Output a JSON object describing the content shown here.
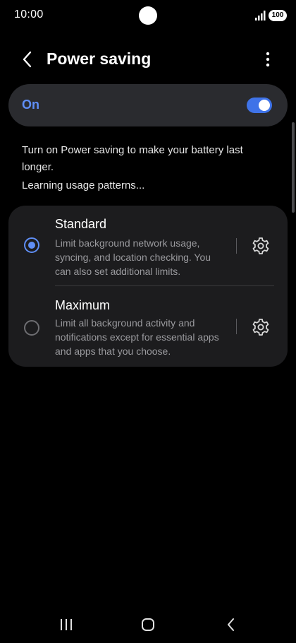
{
  "status_bar": {
    "time": "10:00",
    "battery": "100",
    "icons": [
      "signal-icon",
      "battery-icon"
    ]
  },
  "app_bar": {
    "title": "Power saving",
    "icons": [
      "back-icon",
      "more-icon"
    ]
  },
  "master_switch": {
    "label": "On",
    "checked": true,
    "accent_color": "#5f8ef5"
  },
  "description": {
    "text": "Turn on Power saving to make your battery last longer.",
    "status": "Learning usage patterns..."
  },
  "options": [
    {
      "title": "Standard",
      "description": "Limit background network usage, syncing, and location checking. You can also set additional limits.",
      "selected": true,
      "icon": "gear-icon"
    },
    {
      "title": "Maximum",
      "description": "Limit all background activity and notifications except for essential apps and apps that you choose.",
      "selected": false,
      "icon": "gear-icon"
    }
  ],
  "nav_bar": {
    "icons": [
      "recents-icon",
      "home-icon",
      "back-icon"
    ]
  }
}
